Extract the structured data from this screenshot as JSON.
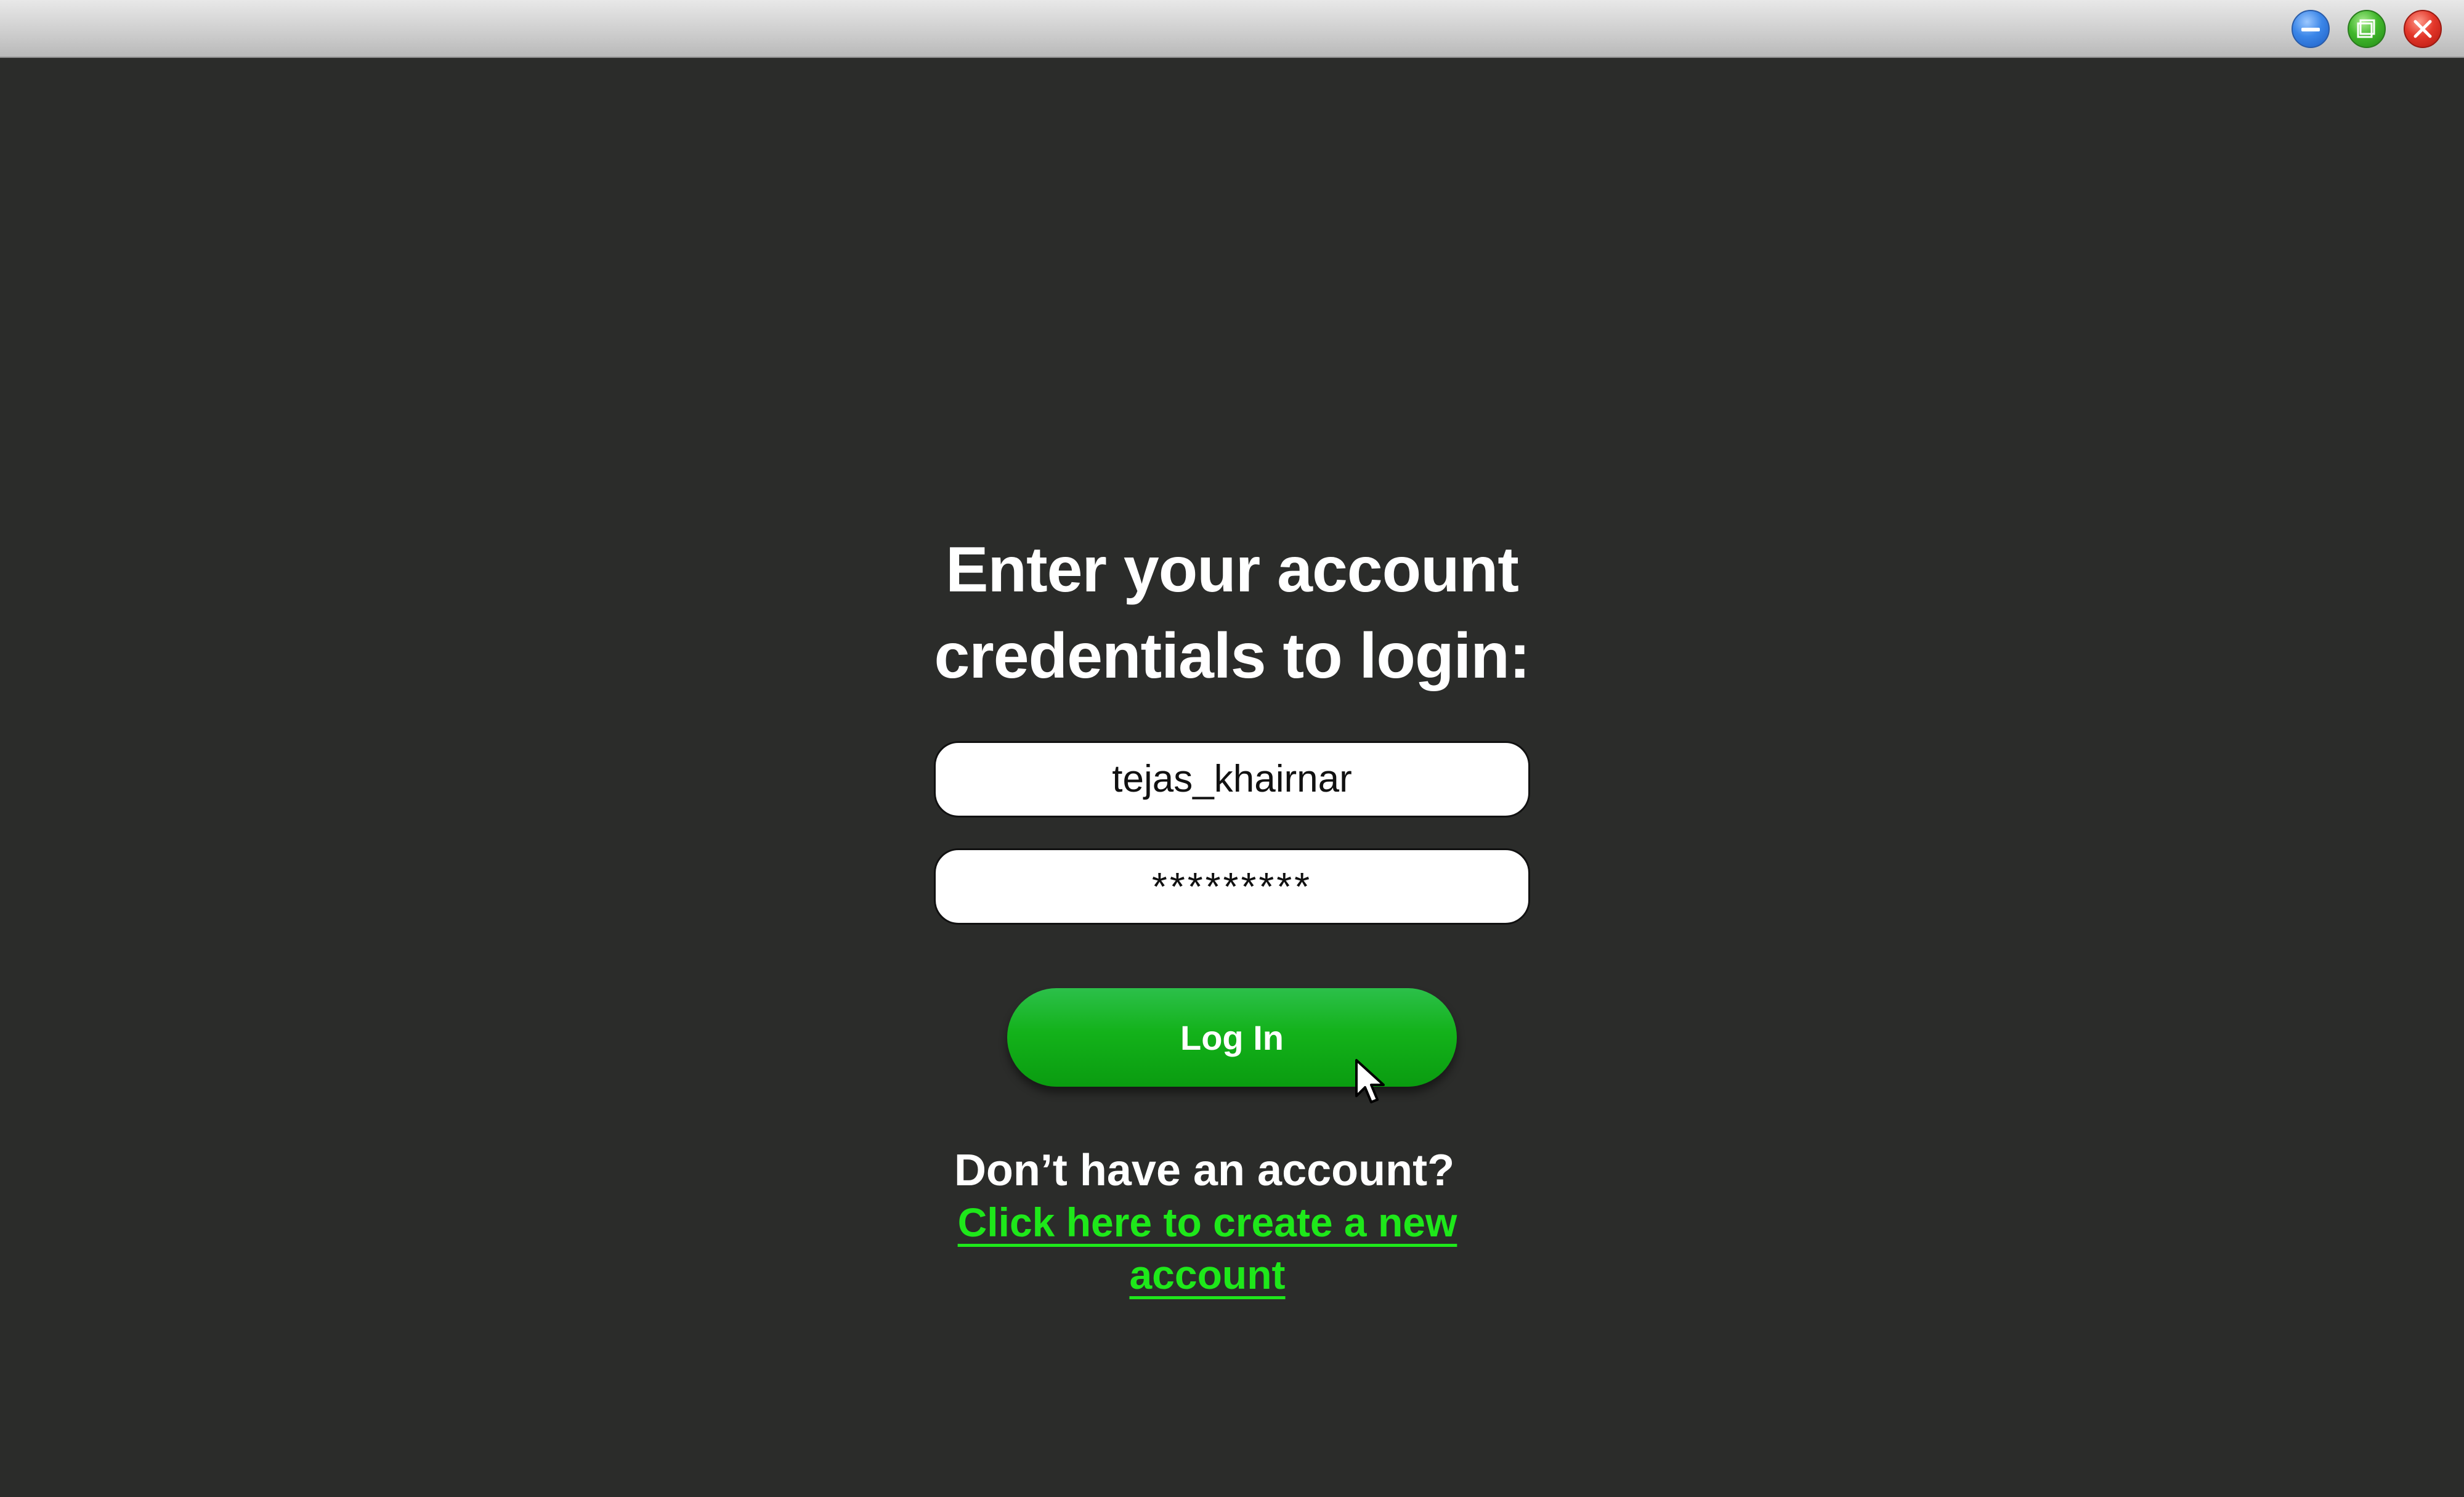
{
  "window": {
    "controls": {
      "minimize_icon": "minimize-icon",
      "maximize_icon": "maximize-icon",
      "close_icon": "close-icon",
      "minimize_color": "#3b86e8",
      "maximize_color": "#41b72c",
      "close_color": "#e3372a"
    }
  },
  "login": {
    "heading_line1": "Enter your account",
    "heading_line2": "credentials to login:",
    "username_value": "tejas_khairnar",
    "password_value": "*********",
    "login_button_label": "Log In",
    "signup_prompt": "Don’t have an account?",
    "signup_link": "Click here to create a new account"
  },
  "colors": {
    "background": "#2b2c2a",
    "accent_green": "#13b21a",
    "link_green": "#1ee81a",
    "text_white": "#ffffff"
  },
  "cursor": {
    "icon": "mouse-pointer-icon"
  }
}
